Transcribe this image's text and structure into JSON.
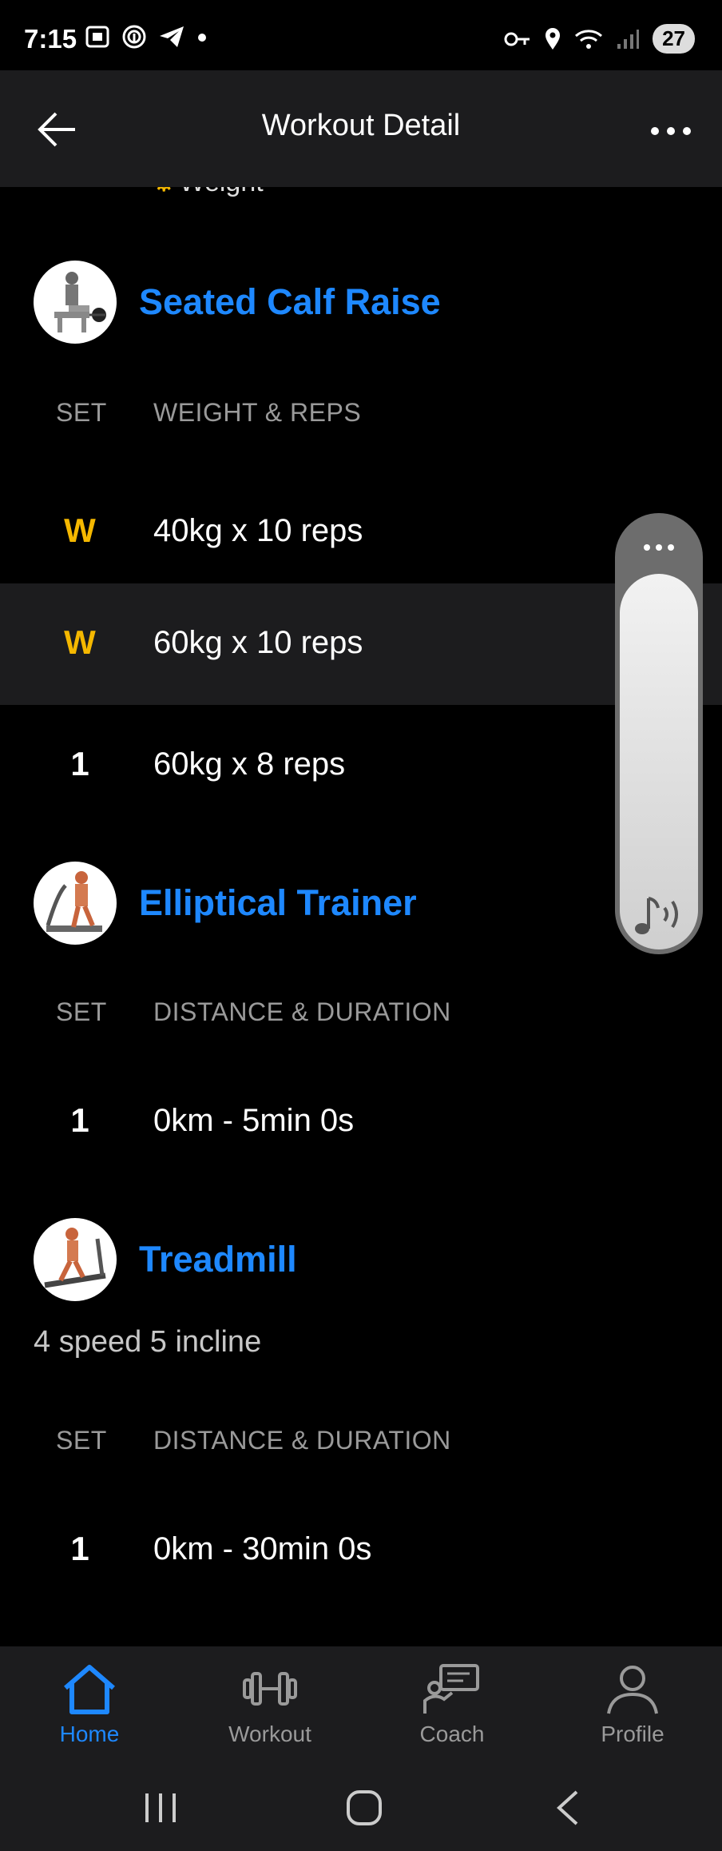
{
  "status_bar": {
    "time": "7:15",
    "battery": "27"
  },
  "header": {
    "title": "Workout Detail"
  },
  "cut_label": "Weight",
  "exercises": [
    {
      "name": "Seated Calf Raise",
      "columns": {
        "set": "SET",
        "metric": "WEIGHT & REPS"
      },
      "rows": [
        {
          "set": "W",
          "value": "40kg x 10 reps"
        },
        {
          "set": "W",
          "value": "60kg x 10 reps"
        },
        {
          "set": "1",
          "value": "60kg x 8 reps"
        }
      ]
    },
    {
      "name": "Elliptical Trainer",
      "columns": {
        "set": "SET",
        "metric": "DISTANCE & DURATION"
      },
      "rows": [
        {
          "set": "1",
          "value": "0km - 5min 0s"
        }
      ]
    },
    {
      "name": "Treadmill",
      "note": "4 speed 5 incline",
      "columns": {
        "set": "SET",
        "metric": "DISTANCE & DURATION"
      },
      "rows": [
        {
          "set": "1",
          "value": "0km - 30min 0s"
        }
      ]
    }
  ],
  "volume_level": 0.86,
  "bottom_nav": [
    {
      "label": "Home",
      "icon": "home-icon",
      "active": true
    },
    {
      "label": "Workout",
      "icon": "dumbbell-icon",
      "active": false
    },
    {
      "label": "Coach",
      "icon": "coach-icon",
      "active": false
    },
    {
      "label": "Profile",
      "icon": "profile-icon",
      "active": false
    }
  ],
  "colors": {
    "accent": "#1e88ff",
    "warmup": "#f5b800",
    "background": "#000000",
    "surface": "#1c1c1e"
  }
}
